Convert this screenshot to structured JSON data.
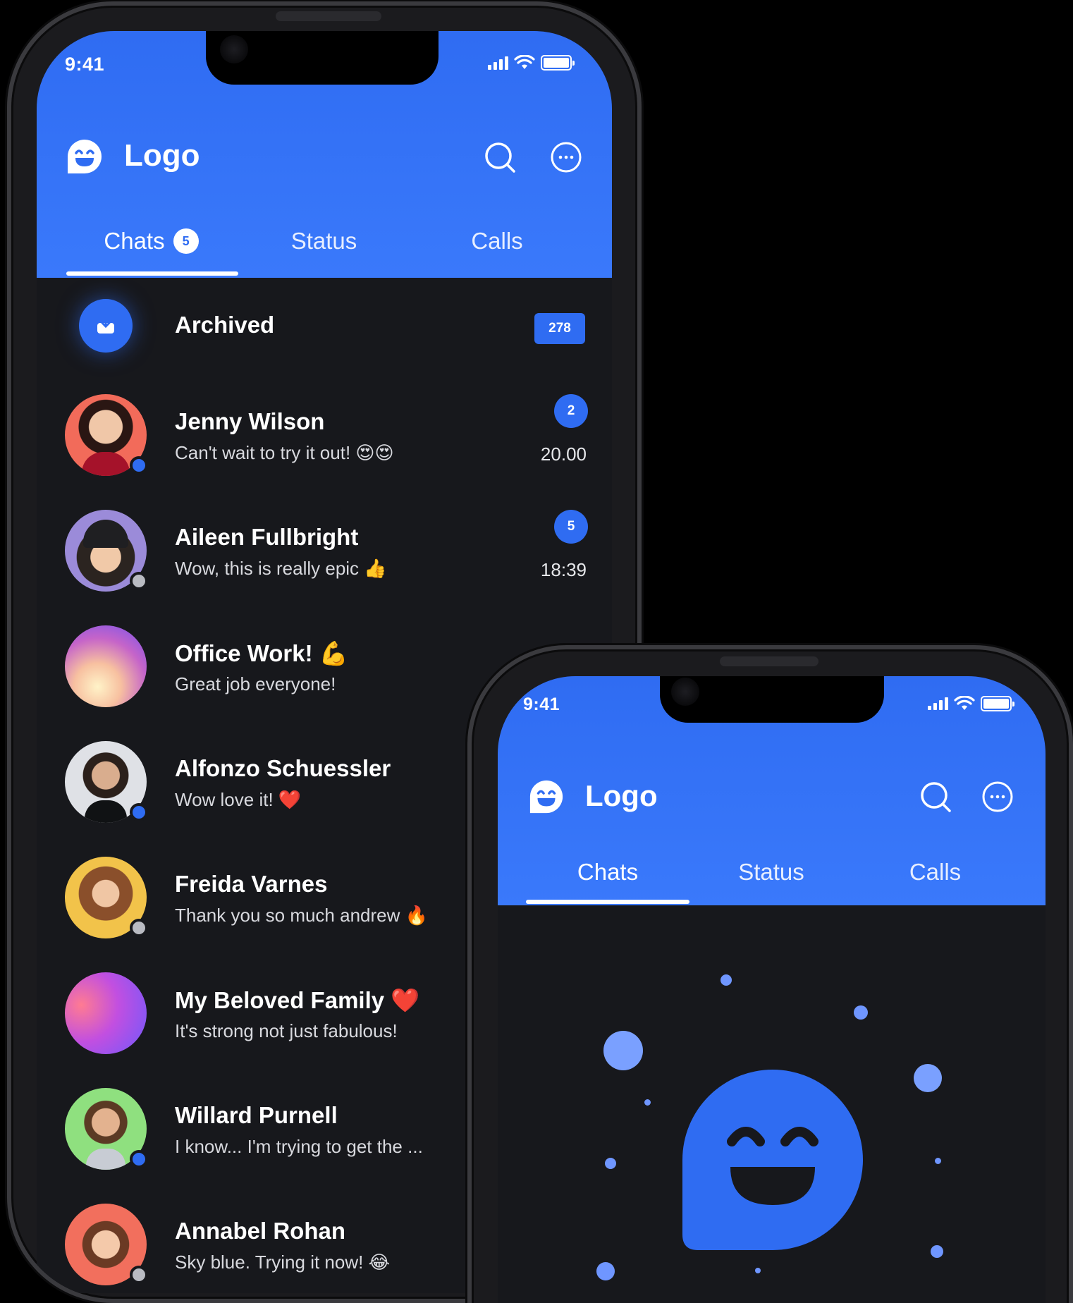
{
  "colors": {
    "accent": "#2f6cf2",
    "background": "#17181c",
    "online": "#2f6cf2",
    "offline": "#b9bbc2"
  },
  "phone_large": {
    "status_time": "9:41",
    "logo_text": "Logo",
    "tabs": [
      {
        "label": "Chats",
        "badge": "5"
      },
      {
        "label": "Status"
      },
      {
        "label": "Calls"
      }
    ],
    "archived": {
      "label": "Archived",
      "count": "278"
    },
    "chats": [
      {
        "name": "Jenny Wilson",
        "preview": "Can't wait to try it out!",
        "emoji": "😍😍",
        "time": "20.00",
        "unread": "2",
        "presence": "online"
      },
      {
        "name": "Aileen Fullbright",
        "preview": "Wow, this is really epic",
        "emoji": "👍",
        "time": "18:39",
        "unread": "5",
        "presence": "offline"
      },
      {
        "name": "Office Work!",
        "name_emoji": "💪",
        "preview": "Great job everyone!",
        "emoji": "",
        "time": "",
        "unread": "",
        "presence": "none"
      },
      {
        "name": "Alfonzo Schuessler",
        "preview": "Wow love it!",
        "emoji": "❤️",
        "time": "",
        "unread": "",
        "presence": "online"
      },
      {
        "name": "Freida Varnes",
        "preview": "Thank you so much andrew",
        "emoji": "🔥",
        "time": "",
        "unread": "",
        "presence": "offline"
      },
      {
        "name": "My Beloved Family",
        "name_emoji": "❤️",
        "preview": "It's strong not just fabulous!",
        "emoji": "",
        "time": "",
        "unread": "",
        "presence": "none"
      },
      {
        "name": "Willard Purnell",
        "preview": "I know... I'm trying to get the ...",
        "emoji": "",
        "time": "",
        "unread": "",
        "presence": "online"
      },
      {
        "name": "Annabel Rohan",
        "preview": "Sky blue. Trying it now!",
        "emoji": "😂",
        "time": "",
        "unread": "",
        "presence": "offline"
      }
    ]
  },
  "phone_small": {
    "status_time": "9:41",
    "logo_text": "Logo",
    "tabs": [
      {
        "label": "Chats"
      },
      {
        "label": "Status"
      },
      {
        "label": "Calls"
      }
    ]
  }
}
